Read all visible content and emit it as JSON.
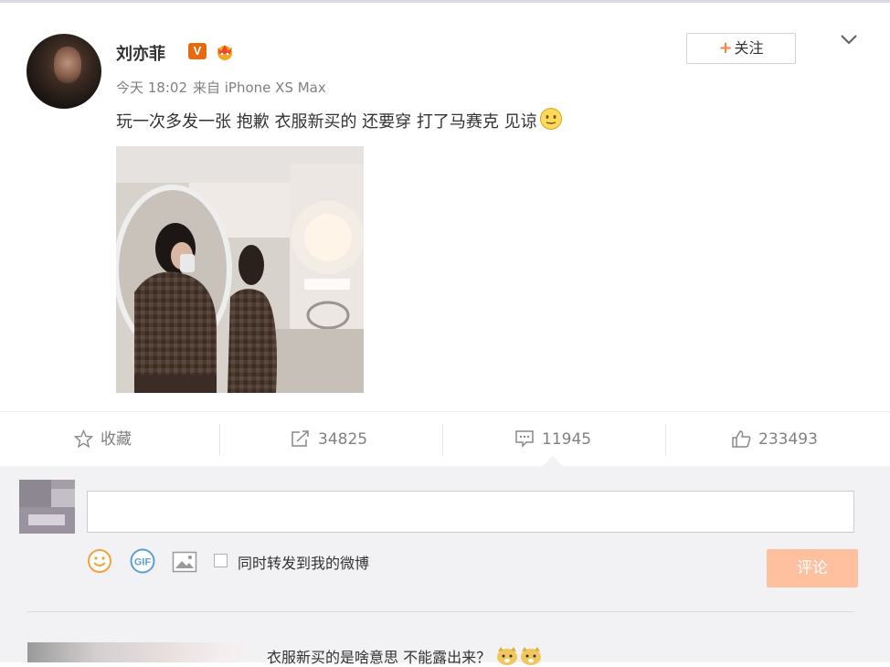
{
  "post": {
    "username": "刘亦菲",
    "verified_badge": "V",
    "time": "今天 18:02",
    "source": "来自 iPhone XS Max",
    "text": "玩一次多发一张 抱歉 衣服新买的 还要穿 打了马赛克 见谅",
    "follow_label": "关注",
    "follow_plus": "+"
  },
  "actions": {
    "favorite_label": "收藏",
    "repost_count": "34825",
    "comment_count": "11945",
    "like_count": "233493"
  },
  "comment_box": {
    "placeholder": "",
    "sync_label": "同时转发到我的微博",
    "submit_label": "评论"
  },
  "comments": [
    {
      "text": "衣服新买的是啥意思 不能露出来？"
    }
  ],
  "colors": {
    "accent": "#ff8140",
    "badge": "#e86a10",
    "submit_disabled": "#ffc09f",
    "icon_blue": "#5b9fd8"
  },
  "icons": [
    "vip-crown-icon",
    "chevron-down-icon",
    "smiley-icon",
    "star-icon",
    "repost-icon",
    "comment-icon",
    "like-icon",
    "emoji-icon",
    "gif-icon",
    "image-icon",
    "checkbox",
    "doge-icon"
  ]
}
